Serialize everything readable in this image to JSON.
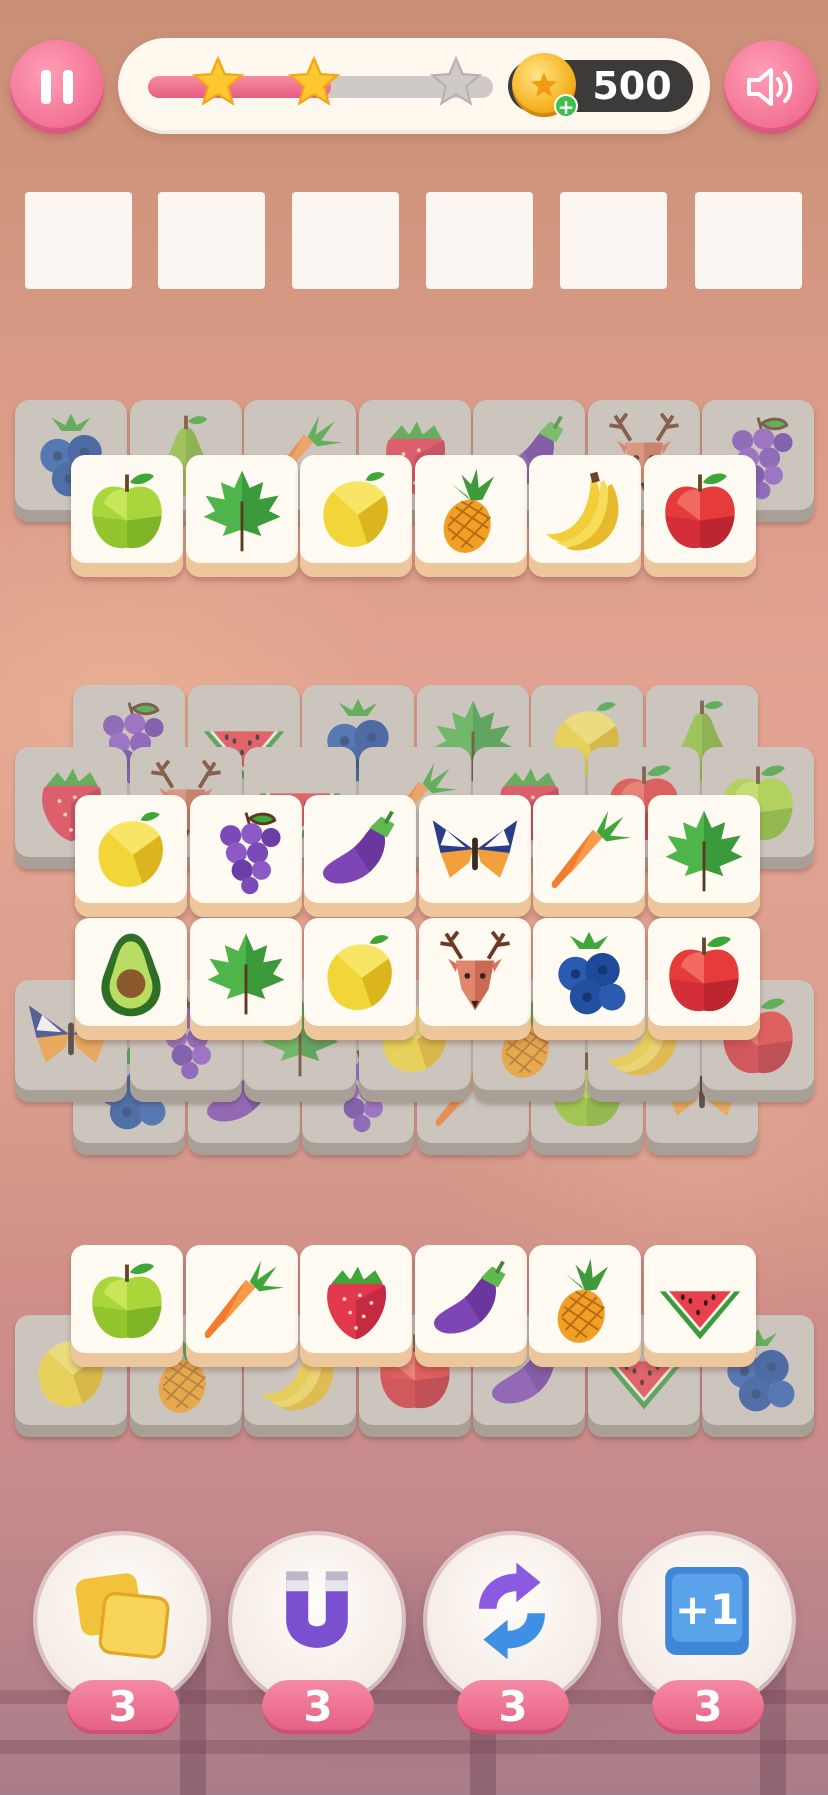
{
  "header": {
    "pause_icon": "pause-icon",
    "sound_icon": "speaker-icon",
    "level_progress": 0.53,
    "stars_earned": 2,
    "stars_total": 3,
    "coins": "500",
    "coin_add_label": "+"
  },
  "collection_slots": {
    "count": 6,
    "filled": 0
  },
  "board": {
    "groups": [
      {
        "back_row": [
          "blueberry",
          "pear",
          "carrot",
          "strawberry",
          "eggplant",
          "deer",
          "grapes"
        ],
        "front_row": [
          "green-apple",
          "maple-leaf",
          "lemon",
          "pineapple",
          "banana",
          "red-apple"
        ]
      },
      {
        "back_row_top": [
          "grapes",
          "watermelon",
          "blueberry",
          "maple-leaf",
          "lemon",
          "pear"
        ],
        "back_row_mid": [
          "strawberry",
          "deer",
          "watermelon",
          "carrot",
          "strawberry",
          "red-apple",
          "green-apple"
        ],
        "front_row_1": [
          "lemon",
          "grapes",
          "eggplant",
          "butterfly",
          "carrot",
          "maple-leaf"
        ],
        "front_row_2": [
          "avocado",
          "maple-leaf",
          "lemon",
          "deer",
          "blueberry",
          "red-apple"
        ],
        "under_row": [
          "butterfly",
          "grapes",
          "maple-leaf",
          "lemon",
          "pineapple",
          "banana",
          "red-apple"
        ],
        "bottom_row": [
          "blueberry",
          "eggplant",
          "grapes",
          "carrot",
          "green-apple",
          "butterfly"
        ]
      },
      {
        "back_row": [
          "lemon",
          "pineapple",
          "banana",
          "red-apple",
          "eggplant",
          "watermelon",
          "blueberry"
        ],
        "front_row": [
          "green-apple",
          "carrot",
          "strawberry",
          "eggplant",
          "pineapple",
          "watermelon"
        ]
      }
    ]
  },
  "boosters": [
    {
      "name": "undo",
      "icon": "yellow-tiles-icon",
      "count": "3"
    },
    {
      "name": "magnet",
      "icon": "magnet-icon",
      "count": "3"
    },
    {
      "name": "shuffle",
      "icon": "shuffle-arrows-icon",
      "count": "3"
    },
    {
      "name": "extra-slot",
      "icon": "plus-one-icon",
      "count": "3",
      "label": "+1"
    }
  ]
}
